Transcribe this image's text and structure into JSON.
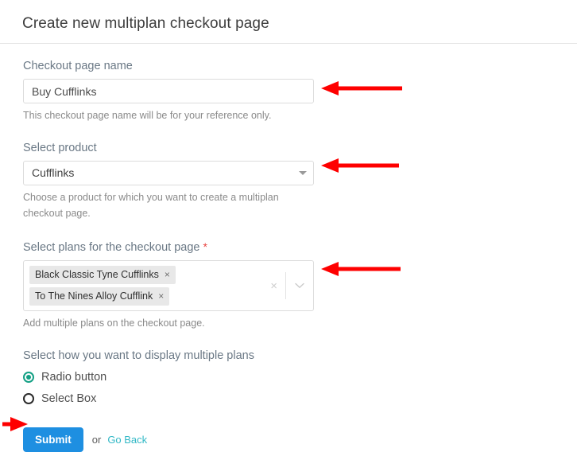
{
  "header": {
    "title": "Create new multiplan checkout page"
  },
  "form": {
    "name_field": {
      "label": "Checkout page name",
      "value": "Buy Cufflinks",
      "placeholder": "Checkout page name",
      "help": "This checkout page name will be for your reference only."
    },
    "product_field": {
      "label": "Select product",
      "selected": "Cufflinks",
      "help": "Choose a product for which you want to create a multiplan checkout page.",
      "caret_icon": "chevron-down-icon"
    },
    "plans_field": {
      "label": "Select plans for the checkout page",
      "required_marker": "*",
      "chips": [
        {
          "label": "Black Classic Tyne Cufflinks",
          "remove_icon": "×"
        },
        {
          "label": "To The Nines Alloy Cufflink",
          "remove_icon": "×"
        }
      ],
      "clear_icon": "×",
      "dropdown_icon": "chevron-down-icon",
      "help": "Add multiple plans on the checkout page."
    },
    "display_mode": {
      "label": "Select how you want to display multiple plans",
      "options": [
        {
          "label": "Radio button",
          "selected": true
        },
        {
          "label": "Select Box",
          "selected": false
        }
      ]
    },
    "actions": {
      "submit_label": "Submit",
      "or_label": "or",
      "goback_label": "Go Back"
    }
  },
  "annotations": {
    "arrow_color": "#fe0000",
    "arrows": [
      {
        "name": "arrow-to-name-input",
        "direction": "left"
      },
      {
        "name": "arrow-to-product-select",
        "direction": "left"
      },
      {
        "name": "arrow-to-plans-multiselect",
        "direction": "left"
      },
      {
        "name": "arrow-to-submit-button",
        "direction": "right"
      }
    ]
  },
  "colors": {
    "submit_blue": "#1e8fe1",
    "link_teal": "#32b8c6",
    "radio_teal": "#14a085",
    "required_red": "#e8423f",
    "arrow_red": "#fe0000"
  }
}
